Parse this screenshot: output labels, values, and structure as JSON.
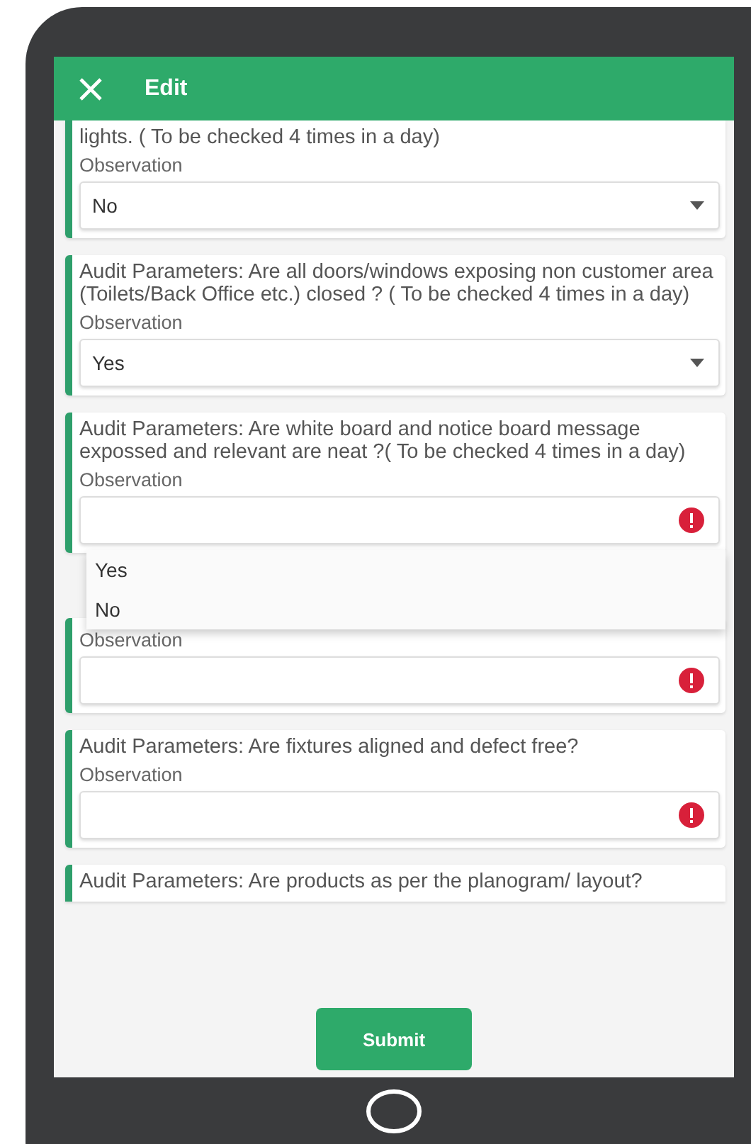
{
  "header": {
    "title": "Edit"
  },
  "cards": [
    {
      "question": "lights. ( To be checked 4 times in a day)",
      "observation_label": "Observation",
      "field": {
        "kind": "select",
        "value": "No"
      }
    },
    {
      "question": "Audit Parameters: Are all doors/windows exposing non customer area (Toilets/Back Office etc.) closed ? ( To be checked 4 times in a day)",
      "observation_label": "Observation",
      "field": {
        "kind": "select",
        "value": "Yes"
      }
    },
    {
      "question": "Audit Parameters: Are white board and notice board message expossed and relevant are neat ?( To be checked 4 times in a day)",
      "observation_label": "Observation",
      "field": {
        "kind": "error",
        "options": [
          {
            "label": "Yes"
          },
          {
            "label": "No"
          }
        ]
      }
    },
    {
      "observation_label": "Observation",
      "field": {
        "kind": "error"
      }
    },
    {
      "question": "Audit Parameters: Are fixtures aligned and defect free?",
      "observation_label": "Observation",
      "field": {
        "kind": "error"
      }
    },
    {
      "question": "Audit Parameters: Are products as per the planogram/ layout?"
    }
  ],
  "submit_button": "Submit"
}
